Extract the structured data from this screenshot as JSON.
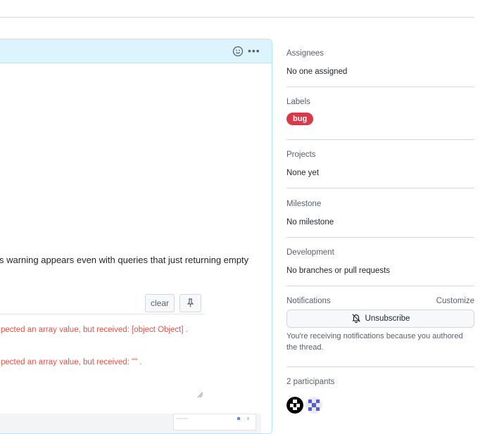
{
  "comment": {
    "body_fragment": "s warning appears even with queries that just returning empty",
    "console": {
      "clear_label": "clear",
      "errors": [
        "pected an array value, but received: [object Object] .",
        "pected an array value, but received: \"\" ."
      ]
    }
  },
  "sidebar": {
    "assignees": {
      "title": "Assignees",
      "value": "No one assigned"
    },
    "labels": {
      "title": "Labels",
      "items": [
        {
          "name": "bug",
          "color": "#d73a4a"
        }
      ]
    },
    "projects": {
      "title": "Projects",
      "value": "None yet"
    },
    "milestone": {
      "title": "Milestone",
      "value": "No milestone"
    },
    "development": {
      "title": "Development",
      "value": "No branches or pull requests"
    },
    "notifications": {
      "title": "Notifications",
      "customize_label": "Customize",
      "unsubscribe_label": "Unsubscribe",
      "description": "You're receiving notifications because you authored the thread."
    },
    "participants": {
      "title": "2 participants"
    }
  },
  "colors": {
    "accent_header": "#ddf4ff",
    "error_text": "#e5534b",
    "label_bug": "#d73a4a"
  }
}
